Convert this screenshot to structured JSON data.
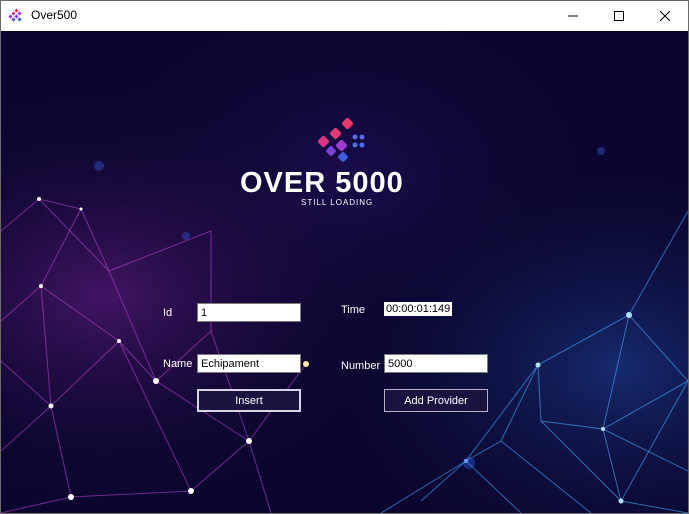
{
  "window": {
    "title": "Over500",
    "icon": "app-logo-icon",
    "controls": [
      "minimize-icon",
      "maximize-icon",
      "close-icon"
    ]
  },
  "logo": {
    "title": "OVER 5000",
    "subtitle": "STILL LOADING",
    "colors": {
      "pink": "#e8386b",
      "purple": "#a03ccf",
      "blue": "#3f5fe0"
    }
  },
  "form": {
    "id_label": "Id",
    "id_value": "1",
    "time_label": "Time",
    "time_value": "00:00:01:149",
    "name_label": "Name",
    "name_value": "Echipament",
    "number_label": "Number",
    "number_value": "5000",
    "insert_label": "Insert",
    "add_provider_label": "Add Provider"
  },
  "theme": {
    "background": "#0a0628",
    "accent_blue": "#4aa8ff",
    "accent_magenta": "#c03cd8"
  }
}
